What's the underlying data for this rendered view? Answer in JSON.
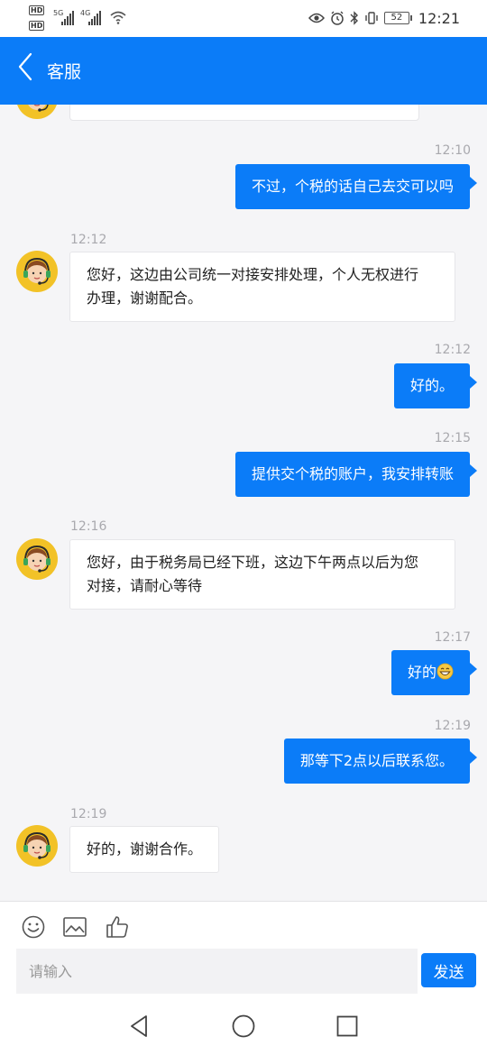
{
  "status_bar": {
    "network_1": "5G",
    "network_2": "4G",
    "hd_label": "HD",
    "battery": "52",
    "time": "12:21",
    "icons": [
      "eye-icon",
      "alarm-icon",
      "bluetooth-icon",
      "vibrate-icon"
    ]
  },
  "header": {
    "title": "客服",
    "back_icon": "chevron-left-icon"
  },
  "messages": [
    {
      "time": "12:10",
      "side": "out",
      "text": "不过，个税的话自己去交可以吗"
    },
    {
      "time": "12:12",
      "side": "in",
      "lines": [
        "您好，这边由公司统一对接安排处理，个人无权进行",
        "办理，谢谢配合。"
      ]
    },
    {
      "time": "12:12",
      "side": "out",
      "text": "好的。"
    },
    {
      "time": "12:15",
      "side": "out",
      "text": "提供交个税的账户，我安排转账"
    },
    {
      "time": "12:16",
      "side": "in",
      "lines": [
        "您好，由于税务局已经下班，这边下午两点以后为您",
        "对接，请耐心等待"
      ]
    },
    {
      "time": "12:17",
      "side": "out",
      "text": "好的",
      "emoji": "grinning-face-emoji"
    },
    {
      "time": "12:19",
      "side": "out",
      "text": "那等下2点以后联系您。"
    },
    {
      "time": "12:19",
      "side": "in",
      "lines": [
        "好的，谢谢合作。"
      ]
    }
  ],
  "composer": {
    "tools": [
      "smiley-icon",
      "image-icon",
      "thumbs-up-icon"
    ],
    "placeholder": "请输入",
    "value": "",
    "send_label": "发送"
  },
  "nav": {
    "buttons": [
      "back-triangle-icon",
      "home-circle-icon",
      "recents-square-icon"
    ]
  },
  "colors": {
    "accent": "#0b7cf8",
    "background": "#f5f5f7",
    "avatar_bg": "#f2c227"
  }
}
